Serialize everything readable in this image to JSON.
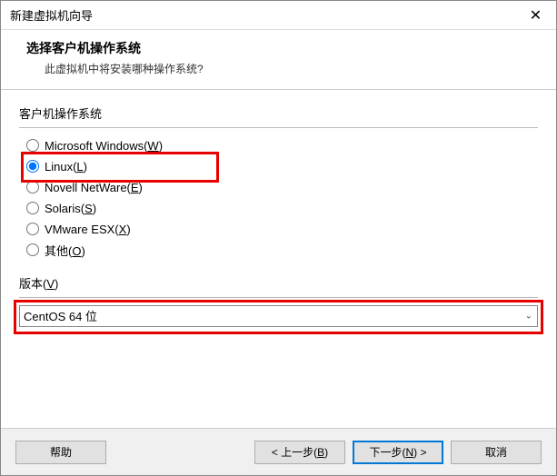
{
  "window": {
    "title": "新建虚拟机向导",
    "close": "✕"
  },
  "header": {
    "title": "选择客户机操作系统",
    "subtitle": "此虚拟机中将安装哪种操作系统?"
  },
  "osGroup": {
    "label": "客户机操作系统",
    "options": [
      {
        "label": "Microsoft Windows(",
        "mnemonic": "W",
        "suffix": ")",
        "selected": false
      },
      {
        "label": "Linux(",
        "mnemonic": "L",
        "suffix": ")",
        "selected": true
      },
      {
        "label": "Novell NetWare(",
        "mnemonic": "E",
        "suffix": ")",
        "selected": false
      },
      {
        "label": "Solaris(",
        "mnemonic": "S",
        "suffix": ")",
        "selected": false
      },
      {
        "label": "VMware ESX(",
        "mnemonic": "X",
        "suffix": ")",
        "selected": false
      },
      {
        "label": "其他(",
        "mnemonic": "O",
        "suffix": ")",
        "selected": false
      }
    ]
  },
  "version": {
    "label_prefix": "版本(",
    "label_mnemonic": "V",
    "label_suffix": ")",
    "selected": "CentOS 64 位"
  },
  "footer": {
    "help": "帮助",
    "back_prefix": "< 上一步(",
    "back_mnemonic": "B",
    "back_suffix": ")",
    "next_prefix": "下一步(",
    "next_mnemonic": "N",
    "next_suffix": ") >",
    "cancel": "取消"
  }
}
